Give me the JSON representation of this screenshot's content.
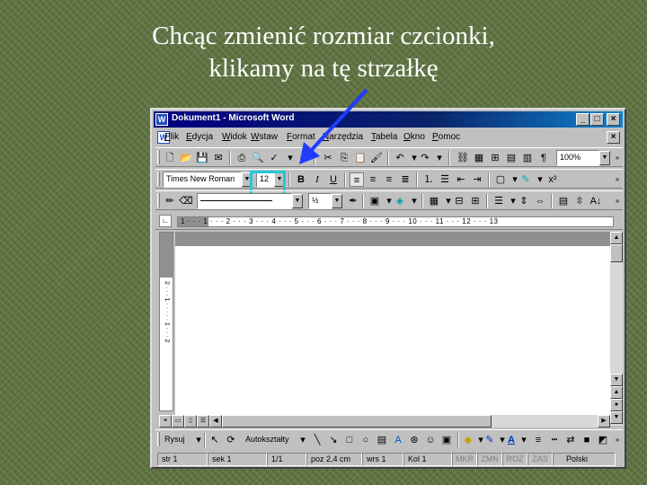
{
  "slide": {
    "title_line1": "Chcąc zmienić rozmiar czcionki,",
    "title_line2": "klikamy na tę strzałkę"
  },
  "window": {
    "title": "Dokument1 - Microsoft Word",
    "app_icon": "W",
    "minimize": "_",
    "maximize": "□",
    "close": "×"
  },
  "menubar": {
    "items": [
      "Plik",
      "Edycja",
      "Widok",
      "Wstaw",
      "Format",
      "Narzędzia",
      "Tabela",
      "Okno",
      "Pomoc"
    ],
    "doc_close": "×"
  },
  "standard_toolbar": {
    "zoom_value": "100%"
  },
  "formatting_toolbar": {
    "font_name": "Times New Roman",
    "font_size": "12",
    "bold": "B",
    "italic": "I",
    "underline": "U",
    "superscript": "x²"
  },
  "tables_toolbar": {
    "line_weight": "½"
  },
  "ruler": {
    "marks": "1 · · · 1 · · · 2 · · · 3 · · · 4 · · · 5 · · · 6 · · · 7 · · · 8 · · · 9 · · · 10 · · · 11 · · · 12 · · · 13",
    "vertical_marks": "2 · · · 1 · · · · · 1 · · · 2"
  },
  "drawing_toolbar": {
    "draw_label": "Rysuj",
    "autoshapes_label": "Autokształty"
  },
  "statusbar": {
    "page": "str 1",
    "section": "sek 1",
    "pages": "1/1",
    "position": "poz 2,4 cm",
    "line": "wrs 1",
    "column": "Kol 1",
    "rec": "MKR",
    "trk": "ZMN",
    "ext": "ROZ",
    "ovr": "ZAS",
    "language": "Polski"
  },
  "colors": {
    "background": "#5f7442",
    "titlebar": "#000080",
    "highlight": "#22c9d6",
    "pointer_arrow": "#1f3cff"
  },
  "icons": {
    "pointer": "blue-arrow-pointer-icon"
  }
}
